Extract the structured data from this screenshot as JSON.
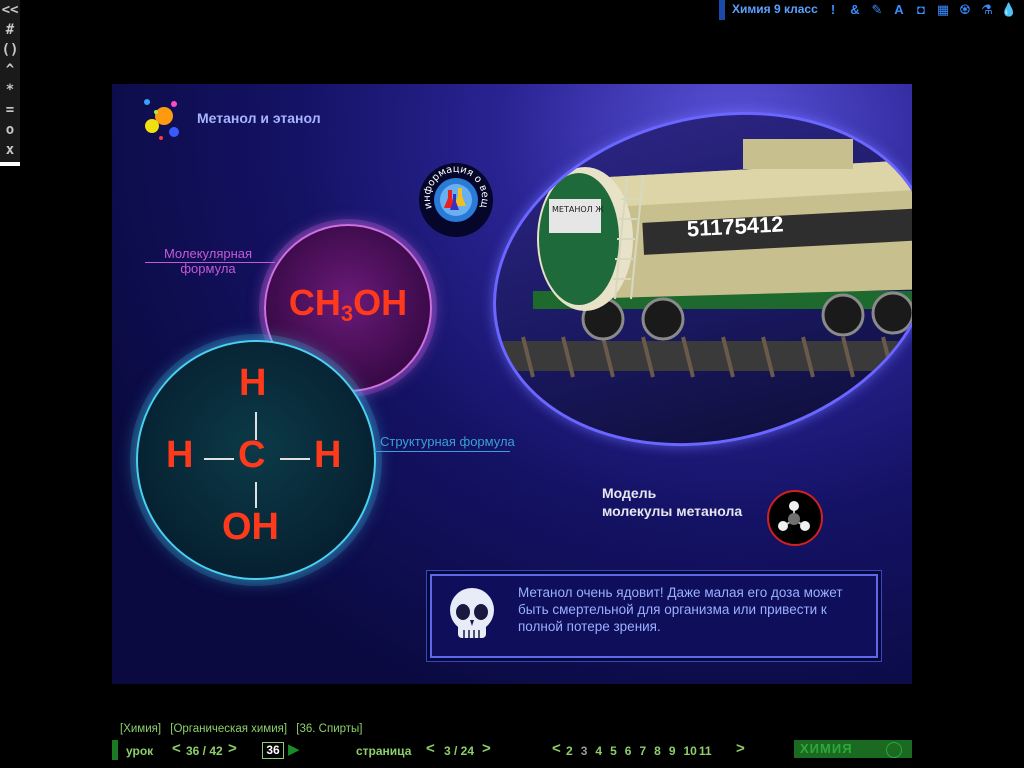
{
  "left_toolbar": {
    "buttons": [
      {
        "glyph": "<<"
      },
      {
        "glyph": "#"
      },
      {
        "glyph": "()"
      },
      {
        "glyph": "^"
      },
      {
        "glyph": "*"
      },
      {
        "glyph": "="
      },
      {
        "glyph": "o"
      },
      {
        "glyph": "x"
      }
    ]
  },
  "header": {
    "course_title": "Химия 9 класс",
    "icons": [
      {
        "icon": "exclamation-icon",
        "glyph": "!"
      },
      {
        "icon": "ampersand-icon",
        "glyph": "&"
      },
      {
        "icon": "book-icon",
        "glyph": "✎"
      },
      {
        "icon": "letter-a-icon",
        "glyph": "A"
      },
      {
        "icon": "camera-icon",
        "glyph": "◘"
      },
      {
        "icon": "table-icon",
        "glyph": "▦"
      },
      {
        "icon": "molecule-icon",
        "glyph": "♼"
      },
      {
        "icon": "flask-icon",
        "glyph": "⚗"
      },
      {
        "icon": "drop-icon",
        "glyph": "💧"
      }
    ]
  },
  "slide": {
    "title": "Метанол и этанол",
    "info_button": {
      "label": "информация о веществах"
    },
    "molecular_formula": {
      "label_line1": "Молекулярная",
      "label_line2": "формула",
      "formula_part1": "CH",
      "formula_subscript": "3",
      "formula_part2": "OH"
    },
    "structural_formula": {
      "label": "Структурная формула",
      "atom_top": "H",
      "atom_left": "H",
      "atom_center": "C",
      "atom_right": "H",
      "atom_bottom": "OH"
    },
    "tank_photo": {
      "number": "51175412",
      "marking": "МЕТАНОЛ Ж"
    },
    "model": {
      "label_line1": "Модель",
      "label_line2": "молекулы метанола"
    },
    "warning": {
      "text": "Метанол очень ядовит! Даже малая его доза может быть смертельной для организма или привести к полной потере зрения."
    }
  },
  "breadcrumb": [
    "[Химия]",
    "[Органическая химия]",
    "[36. Спирты]"
  ],
  "navigation": {
    "lesson_label": "урок",
    "lesson_value": "36 / 42",
    "lesson_input": "36",
    "page_label": "страница",
    "page_value": "3 / 24",
    "pages": [
      "2",
      "3",
      "4",
      "5",
      "6",
      "7",
      "8",
      "9",
      "10",
      "11"
    ],
    "current_page": "3",
    "brand": "ХИМИЯ"
  },
  "colors": {
    "accent_green": "#8ccf6a",
    "formula_red": "#ff3a1c",
    "header_blue": "#5aa0ff"
  }
}
